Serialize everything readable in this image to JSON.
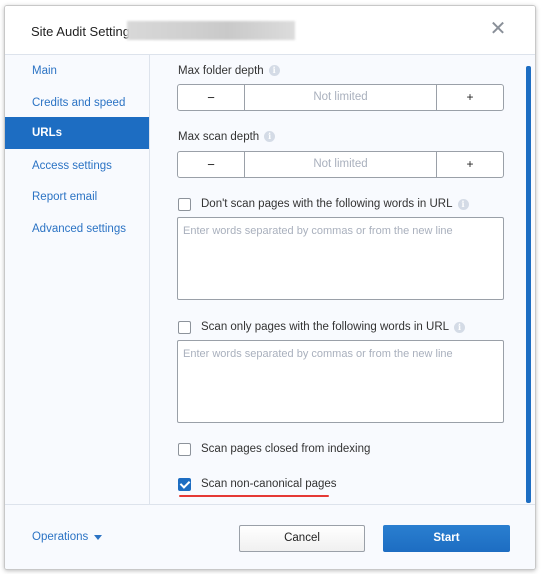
{
  "dialog": {
    "title": "Site Audit Settings",
    "close_icon": "close-icon"
  },
  "sidebar": {
    "items": [
      {
        "label": "Main",
        "active": false
      },
      {
        "label": "Credits and speed",
        "active": false
      },
      {
        "label": "URLs",
        "active": true
      },
      {
        "label": "Access settings",
        "active": false
      },
      {
        "label": "Report email",
        "active": false
      },
      {
        "label": "Advanced settings",
        "active": false
      }
    ]
  },
  "content": {
    "max_folder_depth": {
      "label": "Max folder depth",
      "minus": "−",
      "value": "Not limited",
      "plus": "+"
    },
    "max_scan_depth": {
      "label": "Max scan depth",
      "minus": "−",
      "value": "Not limited",
      "plus": "+"
    },
    "exclude_words": {
      "label": "Don't scan pages with the following words in URL",
      "checked": false,
      "placeholder": "Enter words separated by commas or from the new line",
      "value": ""
    },
    "include_words": {
      "label": "Scan only pages with the following words in URL",
      "checked": false,
      "placeholder": "Enter words separated by commas or from the new line",
      "value": ""
    },
    "scan_closed": {
      "label": "Scan pages closed from indexing",
      "checked": false
    },
    "scan_noncanonical": {
      "label": "Scan non-canonical pages",
      "checked": true
    },
    "info_glyph": "i"
  },
  "footer": {
    "operations_label": "Operations",
    "cancel_label": "Cancel",
    "start_label": "Start"
  },
  "colors": {
    "accent": "#1d6dc2",
    "link": "#2b73c4",
    "highlight_underline": "#e53935"
  }
}
